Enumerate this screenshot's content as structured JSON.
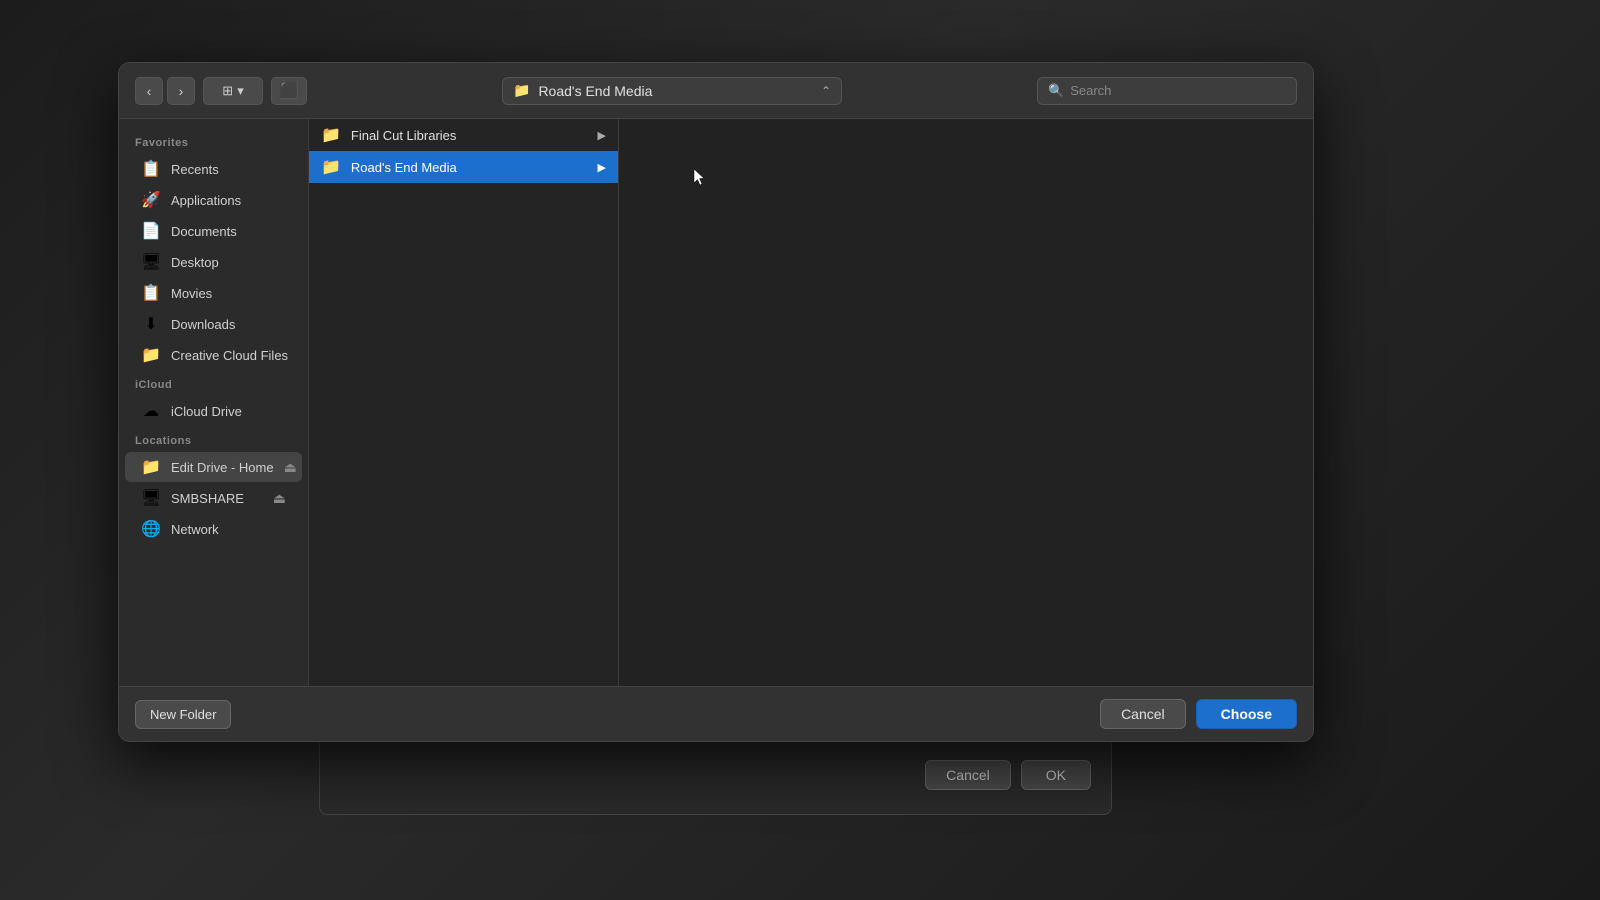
{
  "window": {
    "title": "Road's End Media"
  },
  "toolbar": {
    "back_label": "‹",
    "forward_label": "›",
    "view_label": "⊞",
    "view_chevron": "▾",
    "action_label": "⬛",
    "location_icon": "📁",
    "location_label": "Road's End Media",
    "location_chevron": "⌃",
    "search_placeholder": "Search"
  },
  "sidebar": {
    "favorites_label": "Favorites",
    "icloud_label": "iCloud",
    "locations_label": "Locations",
    "items_favorites": [
      {
        "id": "recents",
        "icon": "📋",
        "label": "Recents"
      },
      {
        "id": "applications",
        "icon": "🚀",
        "label": "Applications"
      },
      {
        "id": "documents",
        "icon": "📄",
        "label": "Documents"
      },
      {
        "id": "desktop",
        "icon": "⬛",
        "label": "Desktop"
      },
      {
        "id": "movies",
        "icon": "📋",
        "label": "Movies"
      },
      {
        "id": "downloads",
        "icon": "⬇",
        "label": "Downloads"
      },
      {
        "id": "creative-cloud",
        "icon": "📁",
        "label": "Creative Cloud Files"
      }
    ],
    "items_icloud": [
      {
        "id": "icloud-drive",
        "icon": "☁",
        "label": "iCloud Drive"
      }
    ],
    "items_locations": [
      {
        "id": "edit-drive",
        "icon": "📁",
        "label": "Edit Drive - Home",
        "eject": true
      },
      {
        "id": "smbshare",
        "icon": "🖥",
        "label": "SMBSHARE",
        "eject": true
      },
      {
        "id": "network",
        "icon": "🌐",
        "label": "Network"
      }
    ]
  },
  "column": {
    "items": [
      {
        "id": "final-cut",
        "icon": "📁",
        "label": "Final Cut Libraries",
        "has_arrow": true,
        "selected": false
      },
      {
        "id": "roads-end",
        "icon": "📁",
        "label": "Road's End Media",
        "has_arrow": true,
        "selected": true
      }
    ]
  },
  "footer": {
    "new_folder_label": "New Folder",
    "cancel_label": "Cancel",
    "choose_label": "Choose"
  },
  "bg_dialog": {
    "cancel_label": "Cancel",
    "ok_label": "OK"
  }
}
